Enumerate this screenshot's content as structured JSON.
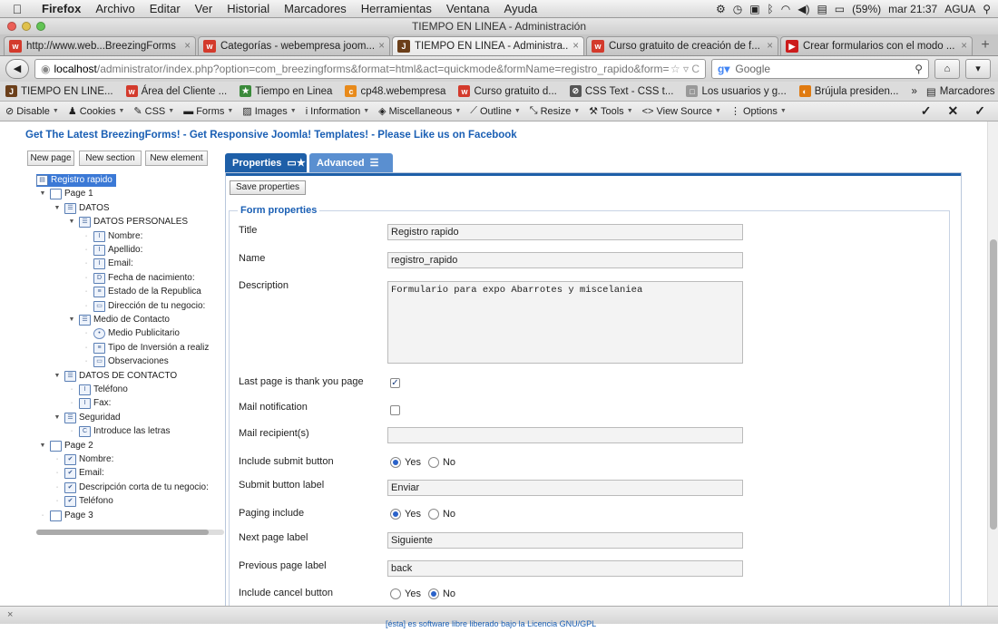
{
  "menubar": {
    "apple": "",
    "items": [
      "Firefox",
      "Archivo",
      "Editar",
      "Ver",
      "Historial",
      "Marcadores",
      "Herramientas",
      "Ventana",
      "Ayuda"
    ],
    "battery": "(59%)",
    "clock": "mar 21:37",
    "user": "AGUA"
  },
  "window": {
    "title": "TIEMPO EN LINEA - Administración"
  },
  "tabs": [
    {
      "label": "http://www.web...BreezingForms",
      "color": "#d33a2c",
      "glyph": "w"
    },
    {
      "label": "Categorías - webempresa joom...",
      "color": "#d33a2c",
      "glyph": "w"
    },
    {
      "label": "TIEMPO EN LINEA - Administra...",
      "color": "#6b3f1a",
      "glyph": "J"
    },
    {
      "label": "Curso gratuito de creación de f...",
      "color": "#d33a2c",
      "glyph": "w"
    },
    {
      "label": "Crear formularios con el modo ...",
      "color": "#cc1b1b",
      "glyph": "▶"
    }
  ],
  "nav": {
    "url_host": "localhost",
    "url_path": "/administrator/index.php?option=com_breezingforms&format=html&act=quickmode&formName=registro_rapido&form=",
    "search_placeholder": "Google"
  },
  "bookmarks": [
    {
      "label": "TIEMPO EN LINE...",
      "color": "#6b3f1a",
      "glyph": "J"
    },
    {
      "label": "Área del Cliente ...",
      "color": "#d33a2c",
      "glyph": "w"
    },
    {
      "label": "Tiempo en Linea",
      "color": "#3a8a3a",
      "glyph": "★"
    },
    {
      "label": "cp48.webempresa",
      "color": "#e88a1a",
      "glyph": "c"
    },
    {
      "label": "Curso gratuito d...",
      "color": "#d33a2c",
      "glyph": "w"
    },
    {
      "label": "CSS Text - CSS t...",
      "color": "#555555",
      "glyph": "⊘"
    },
    {
      "label": "Los usuarios y g...",
      "color": "#999999",
      "glyph": "□"
    },
    {
      "label": "Brújula presiden...",
      "color": "#e07a10",
      "glyph": "◐"
    }
  ],
  "bookmarks_more": "Marcadores",
  "devbar": [
    "Disable",
    "Cookies",
    "CSS",
    "Forms",
    "Images",
    "Information",
    "Miscellaneous",
    "Outline",
    "Resize",
    "Tools",
    "View Source",
    "Options"
  ],
  "page": {
    "promo": "Get The Latest BreezingForms! - Get Responsive Joomla! Templates! - Please Like us on Facebook",
    "toolbar": {
      "new_page": "New page",
      "new_section": "New section",
      "new_element": "New element"
    },
    "tree": [
      {
        "label": "Registro rapido",
        "type": "form",
        "selected": true
      },
      {
        "label": "Page 1",
        "type": "page"
      },
      {
        "label": "DATOS",
        "type": "section"
      },
      {
        "label": "DATOS PERSONALES",
        "type": "section"
      },
      {
        "label": "Nombre:",
        "type": "text"
      },
      {
        "label": "Apellido:",
        "type": "text"
      },
      {
        "label": "Email:",
        "type": "text"
      },
      {
        "label": "Fecha de nacimiento:",
        "type": "date"
      },
      {
        "label": "Estado de la Republica",
        "type": "select"
      },
      {
        "label": "Dirección de tu negocio:",
        "type": "textarea"
      },
      {
        "label": "Medio de Contacto",
        "type": "section"
      },
      {
        "label": "Medio Publicitario",
        "type": "radio"
      },
      {
        "label": "Tipo de Inversión a realiz",
        "type": "select"
      },
      {
        "label": "Observaciones",
        "type": "textarea"
      },
      {
        "label": "DATOS DE CONTACTO",
        "type": "section"
      },
      {
        "label": "Teléfono",
        "type": "text"
      },
      {
        "label": "Fax:",
        "type": "text"
      },
      {
        "label": "Seguridad",
        "type": "section"
      },
      {
        "label": "Introduce las letras",
        "type": "captcha"
      },
      {
        "label": "Page 2",
        "type": "page"
      },
      {
        "label": "Nombre:",
        "type": "summary"
      },
      {
        "label": "Email:",
        "type": "summary"
      },
      {
        "label": "Descripción corta de tu negocio:",
        "type": "summary"
      },
      {
        "label": "Teléfono",
        "type": "summary"
      },
      {
        "label": "Page 3",
        "type": "page"
      }
    ],
    "tabs": {
      "properties": "Properties",
      "advanced": "Advanced"
    },
    "save_properties": "Save properties",
    "legend": "Form properties",
    "fields": {
      "title_label": "Title",
      "title_value": "Registro rapido",
      "name_label": "Name",
      "name_value": "registro_rapido",
      "description_label": "Description",
      "description_value": "Formulario  para expo Abarrotes y miscelaniea",
      "last_page_label": "Last page is thank you page",
      "last_page_checked": true,
      "mail_notification_label": "Mail notification",
      "mail_notification_checked": false,
      "mail_recipients_label": "Mail recipient(s)",
      "mail_recipients_value": "",
      "include_submit_label": "Include submit button",
      "include_submit_value": "Yes",
      "submit_label_label": "Submit button label",
      "submit_label_value": "Enviar",
      "paging_include_label": "Paging include",
      "paging_include_value": "Yes",
      "next_page_label": "Next page label",
      "next_page_value": "Siguiente",
      "prev_page_label": "Previous page label",
      "prev_page_value": "back",
      "include_cancel_label": "Include cancel button",
      "include_cancel_value": "No",
      "yes": "Yes",
      "no": "No"
    }
  },
  "status": {
    "close": "×",
    "footer": "[ésta] es software libre liberado bajo la Licencia GNU/GPL"
  }
}
